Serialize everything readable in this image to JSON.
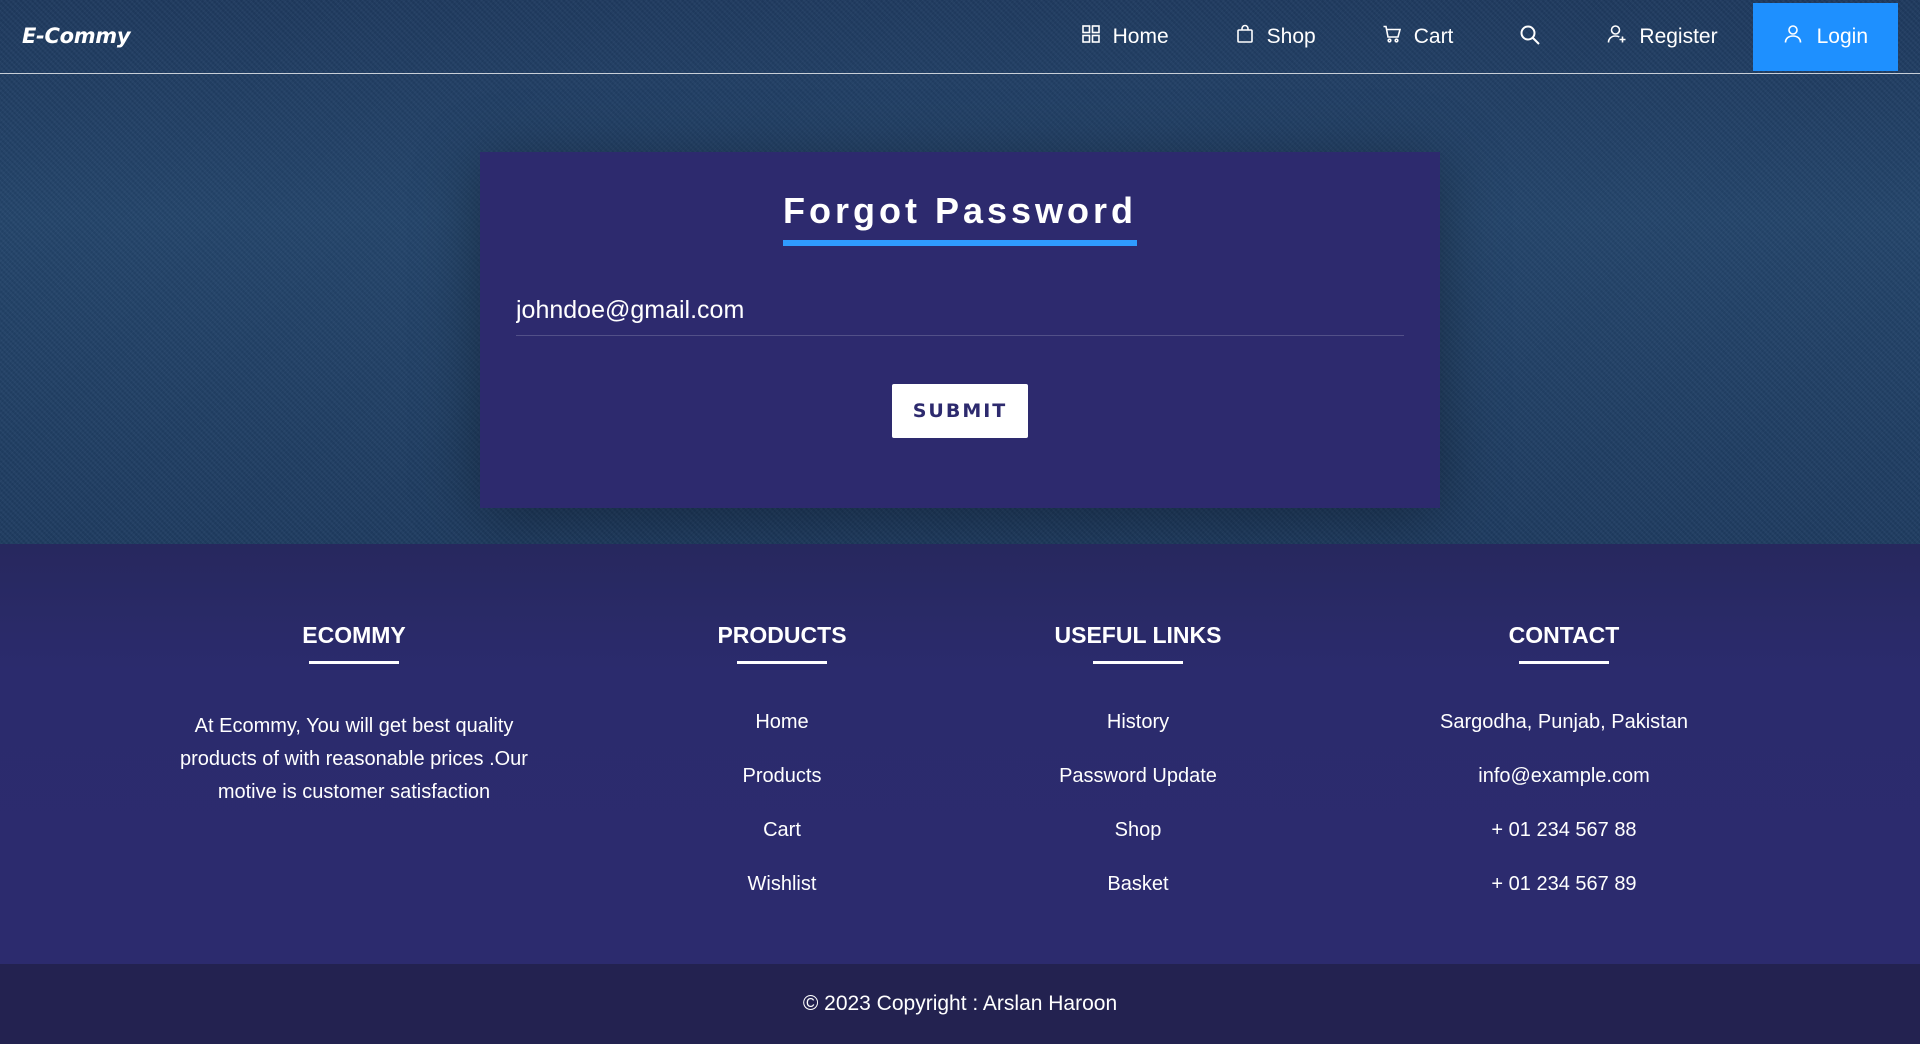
{
  "header": {
    "brand": "E-Commy",
    "nav": {
      "home": "Home",
      "shop": "Shop",
      "cart": "Cart",
      "register": "Register",
      "login": "Login"
    },
    "icons": {
      "home": "grid-icon",
      "shop": "shopping-bag-icon",
      "cart": "cart-icon",
      "search": "search-icon",
      "register": "user-plus-icon",
      "login": "user-icon"
    }
  },
  "form": {
    "title": "Forgot Password",
    "email_value": "johndoe@gmail.com",
    "submit_label": "SUBMIT"
  },
  "footer": {
    "ecommy": {
      "heading": "ECOMMY",
      "text": "At Ecommy, You will get best quality products of with reasonable prices .Our motive is customer satisfaction"
    },
    "products": {
      "heading": "PRODUCTS",
      "items": [
        "Home",
        "Products",
        "Cart",
        "Wishlist"
      ]
    },
    "useful_links": {
      "heading": "USEFUL LINKS",
      "items": [
        "History",
        "Password Update",
        "Shop",
        "Basket"
      ]
    },
    "contact": {
      "heading": "CONTACT",
      "items": [
        "Sargodha, Punjab, Pakistan",
        "info@example.com",
        "+ 01 234 567 88",
        "+ 01 234 567 89"
      ]
    },
    "copyright": "© 2023 Copyright : Arslan Haroon"
  },
  "colors": {
    "accent": "#1e90ff",
    "card": "#2d2a6e",
    "footer": "#2c2b6e",
    "copyright_bar": "#232250",
    "title_underline": "#2f9bff"
  }
}
